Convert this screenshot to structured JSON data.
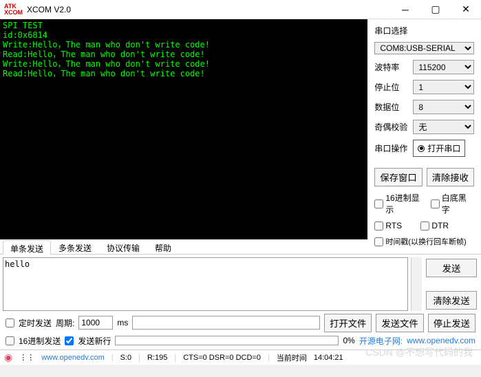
{
  "title": "XCOM V2.0",
  "logo": {
    "l1": "ATK",
    "l2": "XCOM"
  },
  "terminal": "SPI TEST\nid:0x6814\nWrite:Hello，The man who don't write code!\nRead:Hello，The man who don't write code!\nWrite:Hello，The man who don't write code!\nRead:Hello，The man who don't write code!",
  "side": {
    "port_label": "串口选择",
    "port_value": "COM8:USB-SERIAL",
    "baud_label": "波特率",
    "baud_value": "115200",
    "stop_label": "停止位",
    "stop_value": "1",
    "data_label": "数据位",
    "data_value": "8",
    "parity_label": "奇偶校验",
    "parity_value": "无",
    "op_label": "串口操作",
    "open_btn": "打开串口",
    "save_btn": "保存窗口",
    "clear_btn": "清除接收",
    "hex_disp": "16进制显示",
    "white_bg": "白底黑字",
    "rts": "RTS",
    "dtr": "DTR",
    "timestamp": "时间戳(以换行回车断帧)"
  },
  "tabs": [
    "单条发送",
    "多条发送",
    "协议传输",
    "帮助"
  ],
  "send_text": "hello",
  "send_btn": "发送",
  "clear_send_btn": "清除发送",
  "opts": {
    "timed": "定时发送",
    "period_lbl": "周期:",
    "period_val": "1000",
    "ms": "ms",
    "open_file": "打开文件",
    "send_file": "发送文件",
    "stop_send": "停止发送",
    "hex_send": "16进制发送",
    "newline": "发送新行",
    "pct": "0%",
    "openedv_lbl": "开源电子网:",
    "openedv_url": "www.openedv.com"
  },
  "status": {
    "site": "www.openedv.com",
    "s": "S:0",
    "r": "R:195",
    "cts": "CTS=0 DSR=0 DCD=0",
    "time_lbl": "当前时间",
    "time": "14:04:21"
  },
  "watermark": "CSDN @不想写代码的我"
}
